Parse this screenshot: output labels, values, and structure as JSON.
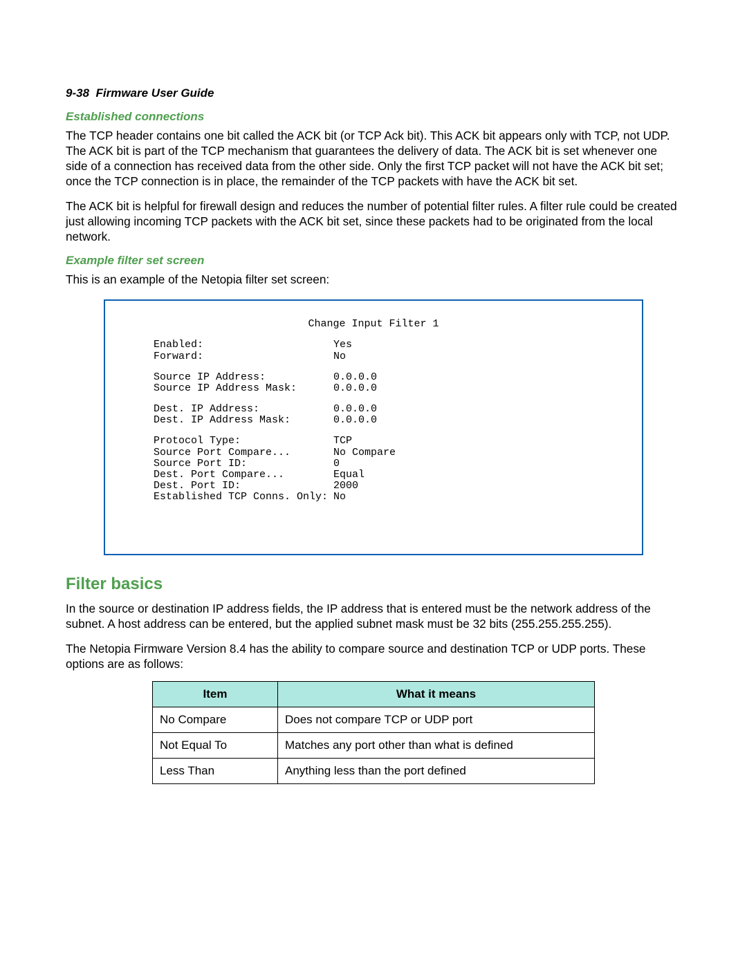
{
  "header": {
    "page_number": "9-38",
    "title": "Firmware User Guide"
  },
  "section1": {
    "heading": "Established connections",
    "para1": "The TCP header contains one bit called the ACK bit (or TCP Ack bit). This ACK bit appears only with TCP, not UDP. The ACK bit is part of the TCP mechanism that guarantees the delivery of data. The ACK bit is set whenever one side of a connection has received data from the other side. Only the first TCP packet will not have the ACK bit set; once the TCP connection is in place, the remainder of the TCP packets with have the ACK bit set.",
    "para2": "The ACK bit is helpful for firewall design and reduces the number of potential filter rules. A filter rule could be created just allowing incoming TCP packets with the ACK bit set, since these packets had to be originated from the local network."
  },
  "section2": {
    "heading": "Example filter set screen",
    "intro": "This is an example of the Netopia filter set screen:"
  },
  "screen": {
    "title": "Change Input Filter 1",
    "rows": [
      {
        "label": "Enabled:",
        "value": "Yes"
      },
      {
        "label": "Forward:",
        "value": "No"
      }
    ],
    "rows2": [
      {
        "label": "Source IP Address:",
        "value": "0.0.0.0"
      },
      {
        "label": "Source IP Address Mask:",
        "value": "0.0.0.0"
      }
    ],
    "rows3": [
      {
        "label": "Dest. IP Address:",
        "value": "0.0.0.0"
      },
      {
        "label": "Dest. IP Address Mask:",
        "value": "0.0.0.0"
      }
    ],
    "rows4": [
      {
        "label": "Protocol Type:",
        "value": "TCP"
      },
      {
        "label": "Source Port Compare...",
        "value": "No Compare"
      },
      {
        "label": "Source Port ID:",
        "value": "0"
      },
      {
        "label": "Dest. Port Compare...",
        "value": "Equal"
      },
      {
        "label": "Dest. Port ID:",
        "value": "2000"
      },
      {
        "label": "Established TCP Conns. Only:",
        "value": "No"
      }
    ]
  },
  "section3": {
    "heading": "Filter basics",
    "para1": "In the source or destination IP address fields, the IP address that is entered must be the network address of the subnet. A host address can be entered, but the applied subnet mask must be 32 bits (255.255.255.255).",
    "para2": "The Netopia Firmware Version 8.4 has the ability to compare source and destination TCP or UDP ports. These options are as follows:"
  },
  "table": {
    "headers": {
      "item": "Item",
      "meaning": "What it means"
    },
    "rows": [
      {
        "item": "No Compare",
        "meaning": "Does not compare TCP or UDP port"
      },
      {
        "item": "Not Equal To",
        "meaning": "Matches any port other than what is defined"
      },
      {
        "item": "Less Than",
        "meaning": "Anything less than the port defined"
      }
    ]
  }
}
